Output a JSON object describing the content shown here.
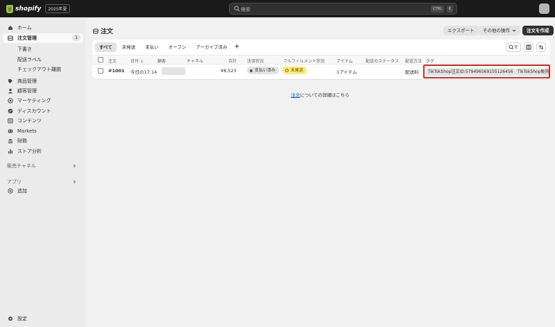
{
  "topbar": {
    "brand": "shopify",
    "edition_badge": "2025年夏",
    "search_placeholder": "検索",
    "kbd_ctrl": "CTRL",
    "kbd_k": "K"
  },
  "sidebar": {
    "items": [
      {
        "label": "ホーム",
        "icon": "home-icon"
      },
      {
        "label": "注文管理",
        "icon": "orders-icon",
        "count": "1",
        "active": true
      },
      {
        "label": "商品管理",
        "icon": "tag-icon"
      },
      {
        "label": "顧客管理",
        "icon": "person-icon"
      },
      {
        "label": "マーケティング",
        "icon": "target-icon"
      },
      {
        "label": "ディスカウント",
        "icon": "discount-icon"
      },
      {
        "label": "コンテンツ",
        "icon": "content-icon"
      },
      {
        "label": "Markets",
        "icon": "globe-icon"
      },
      {
        "label": "財務",
        "icon": "bank-icon"
      },
      {
        "label": "ストア分析",
        "icon": "chart-icon"
      }
    ],
    "sub_items": [
      "下書き",
      "配送ラベル",
      "チェックアウト離脱"
    ],
    "sales_channels": "販売チャネル",
    "apps": "アプリ",
    "add": "追加",
    "settings": "設定"
  },
  "page": {
    "title": "注文",
    "export_label": "エクスポート",
    "more_actions_label": "その他の操作",
    "create_order_label": "注文を作成"
  },
  "tabs": [
    "すべて",
    "未発送",
    "未払い",
    "オープン",
    "アーカイブ済み"
  ],
  "table": {
    "headers": {
      "order": "注文",
      "date": "日付",
      "customer": "顧客",
      "channel": "チャネル",
      "total": "合計",
      "payment_status": "決済状況",
      "fulfillment_status": "フルフィルメント状況",
      "items": "アイテム",
      "delivery_status": "配送のステータス",
      "delivery_method": "配送方法",
      "tags": "タグ"
    },
    "rows": [
      {
        "order": "#1001",
        "date": "今日の17:14",
        "total": "¥8,523",
        "payment_status": "支払い済み",
        "fulfillment_status": "未発送",
        "items": "1アイテム",
        "delivery_method": "配送料",
        "tags": [
          "TikTokShop注文ID:579496569155126456",
          "TikTokShop販売"
        ]
      }
    ]
  },
  "footer": {
    "link": "注文",
    "text": "についての詳細はこちら"
  },
  "colors": {
    "topbar": "#1a1a1a",
    "highlight": "#e0241e",
    "unfulfilled_badge": "#ffeb78",
    "link": "#005bd3"
  }
}
